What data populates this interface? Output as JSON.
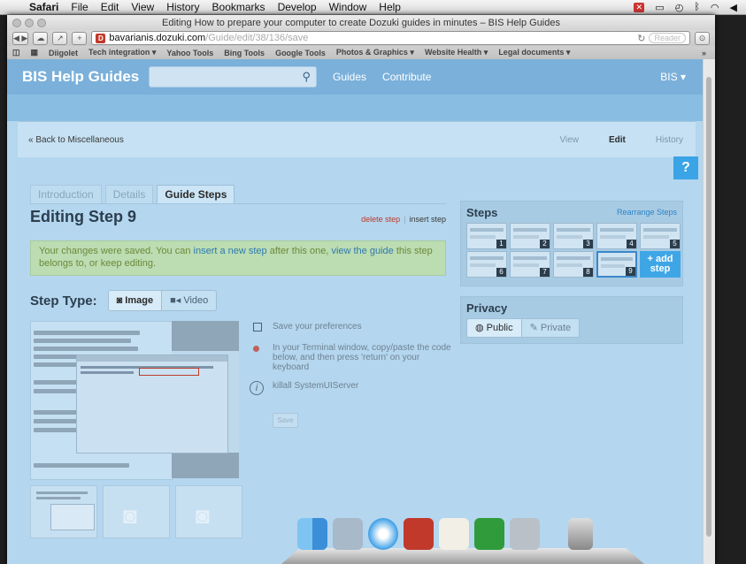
{
  "menubar": {
    "app": "Safari",
    "items": [
      "File",
      "Edit",
      "View",
      "History",
      "Bookmarks",
      "Develop",
      "Window",
      "Help"
    ]
  },
  "browser": {
    "window_title": "Editing How to prepare your computer to create Dozuki guides in minutes – BIS Help Guides",
    "url_host": "bavarianis.dozuki.com",
    "url_path": "/Guide/edit/38/136/save",
    "reader_label": "Reader",
    "bookmarks": [
      "Diigolet",
      "Tech integration ▾",
      "Yahoo Tools",
      "Bing Tools",
      "Google Tools",
      "Photos & Graphics ▾",
      "Website Health ▾",
      "Legal documents ▾"
    ],
    "bookmarks_more": "»"
  },
  "site": {
    "brand": "BIS Help Guides",
    "nav": [
      "Guides",
      "Contribute"
    ],
    "user": "BIS ▾"
  },
  "breadcrumb": {
    "back": "« Back to Miscellaneous",
    "view": "View",
    "edit": "Edit",
    "history": "History"
  },
  "help_tab": "?",
  "tabs": [
    "Introduction",
    "Details",
    "Guide Steps"
  ],
  "editing_title": "Editing Step 9",
  "step_actions": {
    "delete": "delete step",
    "insert": "insert step"
  },
  "notice": {
    "part1": "Your changes were saved. You can ",
    "link1": "insert a new step",
    "part2": " after this one, ",
    "link2": "view the guide",
    "part3": " this step belongs to, or keep editing."
  },
  "step_type": {
    "label": "Step Type:",
    "options": [
      "Image",
      "Video"
    ]
  },
  "instructions": [
    "Save your preferences",
    "In your Terminal window, copy/paste the code below, and then press 'return' on your keyboard",
    "killall SystemUIServer"
  ],
  "save_label": "Save",
  "steps_panel": {
    "title": "Steps",
    "rearrange": "Rearrange Steps",
    "numbers": [
      "1",
      "2",
      "3",
      "4",
      "5",
      "6",
      "7",
      "8",
      "9"
    ],
    "add_line1": "+ add",
    "add_line2": "step"
  },
  "privacy": {
    "title": "Privacy",
    "options": [
      "Public",
      "Private"
    ]
  },
  "colors": {
    "accent": "#3fa6e6",
    "danger": "#c0392b",
    "header": "#7ab0da"
  }
}
